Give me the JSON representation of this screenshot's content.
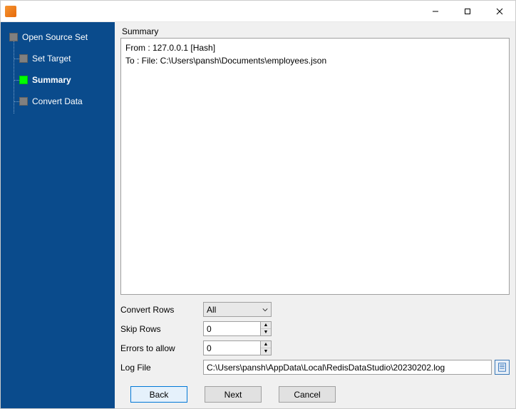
{
  "sidebar": {
    "items": [
      {
        "label": "Open Source Set",
        "child": false,
        "active": false,
        "current": false
      },
      {
        "label": "Set Target",
        "child": true,
        "active": false,
        "current": false
      },
      {
        "label": "Summary",
        "child": true,
        "active": true,
        "current": true
      },
      {
        "label": "Convert Data",
        "child": true,
        "active": false,
        "current": false
      }
    ]
  },
  "content": {
    "section_title": "Summary",
    "summary_text": "From : 127.0.0.1 [Hash]\nTo : File: C:\\Users\\pansh\\Documents\\employees.json"
  },
  "form": {
    "convert_rows_label": "Convert Rows",
    "convert_rows_value": "All",
    "skip_rows_label": "Skip Rows",
    "skip_rows_value": "0",
    "errors_label": "Errors to allow",
    "errors_value": "0",
    "log_label": "Log File",
    "log_value": "C:\\Users\\pansh\\AppData\\Local\\RedisDataStudio\\20230202.log"
  },
  "buttons": {
    "back": "Back",
    "next": "Next",
    "cancel": "Cancel"
  }
}
